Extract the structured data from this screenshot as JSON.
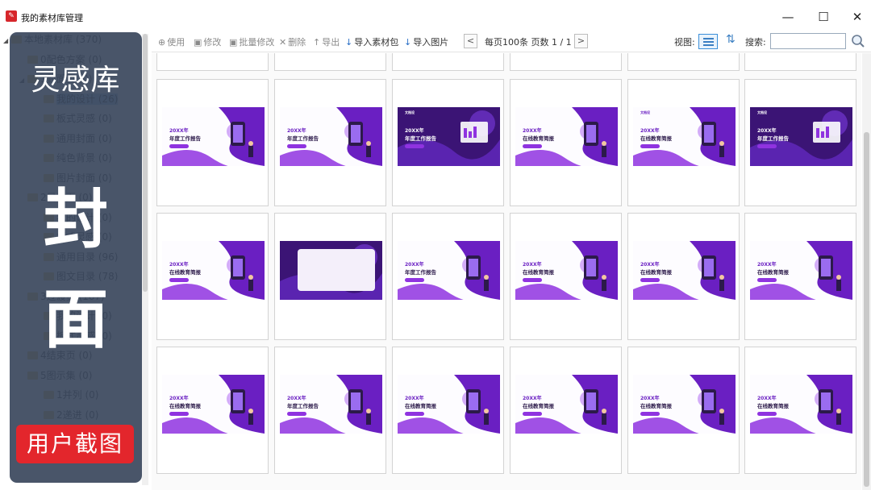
{
  "window": {
    "title": "我的素材库管理",
    "app_icon": "app-logo-icon",
    "controls": [
      "minimize-icon",
      "maximize-icon",
      "close-icon"
    ],
    "control_glyphs": {
      "minimize": "—",
      "maximize": "☐",
      "close": "✕"
    }
  },
  "toolbar": {
    "use": "使用",
    "edit": "修改",
    "batch_edit": "批量修改",
    "delete": "删除",
    "export": "导出",
    "import_pack": "导入素材包",
    "import_image": "导入图片",
    "page_info": "每页100条  页数 1 / 1",
    "prev": "<",
    "next": ">",
    "view_label": "视图:",
    "search_label": "搜索:",
    "search_value": ""
  },
  "tree": {
    "items": [
      {
        "label": "本地素材库 (370)",
        "level": 0,
        "expanded": true
      },
      {
        "label": "0配色方案 (0)",
        "level": 1
      },
      {
        "label": "1封面页 (0)",
        "level": 1,
        "expanded": true
      },
      {
        "label": "我的设计 (26)",
        "level": 2,
        "selected": true
      },
      {
        "label": "板式灵感 (0)",
        "level": 2
      },
      {
        "label": "通用封面 (0)",
        "level": 2
      },
      {
        "label": "纯色背景 (0)",
        "level": 2
      },
      {
        "label": "图片封面 (0)",
        "level": 2
      },
      {
        "label": "2目录页 (0)",
        "level": 1
      },
      {
        "label": "我的设计 (0)",
        "level": 2
      },
      {
        "label": "板式灵感 (0)",
        "level": 2
      },
      {
        "label": "通用目录 (96)",
        "level": 2
      },
      {
        "label": "图文目录 (78)",
        "level": 2
      },
      {
        "label": "3过渡页 (167)",
        "level": 1
      },
      {
        "label": "我的设计 (0)",
        "level": 2
      },
      {
        "label": "板式灵感 (0)",
        "level": 2
      },
      {
        "label": "4结束页 (0)",
        "level": 1
      },
      {
        "label": "5图示集 (0)",
        "level": 1
      },
      {
        "label": "1并列 (0)",
        "level": 2
      },
      {
        "label": "2递进 (0)",
        "level": 2
      },
      {
        "label": "3循环 (0)",
        "level": 2
      }
    ]
  },
  "overlay": {
    "title": "灵感库",
    "big1": "封",
    "big2": "面",
    "button": "用户截图"
  },
  "thumbnails": [
    {
      "line1": "20XX年",
      "line2": "年度工作报告",
      "dark": false,
      "brand": ""
    },
    {
      "line1": "20XX年",
      "line2": "年度工作报告",
      "dark": false,
      "brand": ""
    },
    {
      "line1": "20XX年",
      "line2": "年度工作报告",
      "dark": true,
      "brand": "文档设"
    },
    {
      "line1": "20XX年",
      "line2": "在线教育简报",
      "dark": false,
      "brand": ""
    },
    {
      "line1": "20XX年",
      "line2": "在线教育简报",
      "dark": false,
      "brand": "文档设"
    },
    {
      "line1": "20XX年",
      "line2": "年度工作报告",
      "dark": true,
      "brand": "文档设"
    },
    {
      "line1": "20XX年",
      "line2": "在线教育简报",
      "dark": false,
      "brand": ""
    },
    {
      "line1": "",
      "line2": "",
      "dark": true,
      "brand": ""
    },
    {
      "line1": "20XX年",
      "line2": "年度工作报告",
      "dark": false,
      "brand": ""
    },
    {
      "line1": "20XX年",
      "line2": "在线教育简报",
      "dark": false,
      "brand": ""
    },
    {
      "line1": "20XX年",
      "line2": "在线教育简报",
      "dark": false,
      "brand": ""
    },
    {
      "line1": "20XX年",
      "line2": "在线教育简报",
      "dark": false,
      "brand": ""
    },
    {
      "line1": "20XX年",
      "line2": "在线教育简报",
      "dark": false,
      "brand": ""
    },
    {
      "line1": "20XX年",
      "line2": "年度工作报告",
      "dark": false,
      "brand": ""
    },
    {
      "line1": "20XX年",
      "line2": "在线教育简报",
      "dark": false,
      "brand": ""
    },
    {
      "line1": "20XX年",
      "line2": "在线教育简报",
      "dark": false,
      "brand": ""
    },
    {
      "line1": "20XX年",
      "line2": "在线教育简报",
      "dark": false,
      "brand": ""
    },
    {
      "line1": "20XX年",
      "line2": "在线教育简报",
      "dark": false,
      "brand": ""
    }
  ],
  "colors": {
    "accent_purple": "#6a1fc2",
    "overlay_bg": "#3a465c",
    "overlay_button": "#e3262c",
    "selection": "#9fc7ee"
  }
}
